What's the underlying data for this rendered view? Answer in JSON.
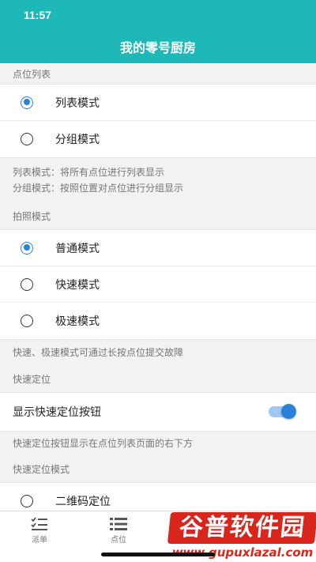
{
  "status_bar": {
    "time": "11:57"
  },
  "header": {
    "title": "我的零号厨房"
  },
  "sections": {
    "point_list": {
      "label": "点位列表",
      "options": [
        {
          "label": "列表模式",
          "checked": true
        },
        {
          "label": "分组模式",
          "checked": false
        }
      ],
      "help": [
        "列表模式：将所有点位进行列表显示",
        "分组模式：按照位置对点位进行分组显示"
      ]
    },
    "photo_mode": {
      "label": "拍照模式",
      "options": [
        {
          "label": "普通模式",
          "checked": true
        },
        {
          "label": "快速模式",
          "checked": false
        },
        {
          "label": "极速模式",
          "checked": false
        }
      ],
      "help": "快速、极速模式可通过长按点位提交故障"
    },
    "quick_locate": {
      "label": "快速定位",
      "switch_label": "显示快速定位按钮",
      "switch_on": true,
      "help": "快速定位按钮显示在点位列表页面的右下方"
    },
    "quick_locate_mode": {
      "label": "快速定位模式",
      "options": [
        {
          "label": "二维码定位",
          "checked": false
        }
      ]
    }
  },
  "tabbar": {
    "tabs": [
      {
        "label": "派单",
        "icon": "checklist-icon"
      },
      {
        "label": "点位",
        "icon": "list-icon"
      }
    ]
  },
  "watermark": {
    "top": "谷普软件园",
    "bottom": "www.gupuxlazal.com"
  },
  "colors": {
    "header": "#1fb8b8",
    "accent": "#2a82d8",
    "watermark": "#d9261c"
  }
}
